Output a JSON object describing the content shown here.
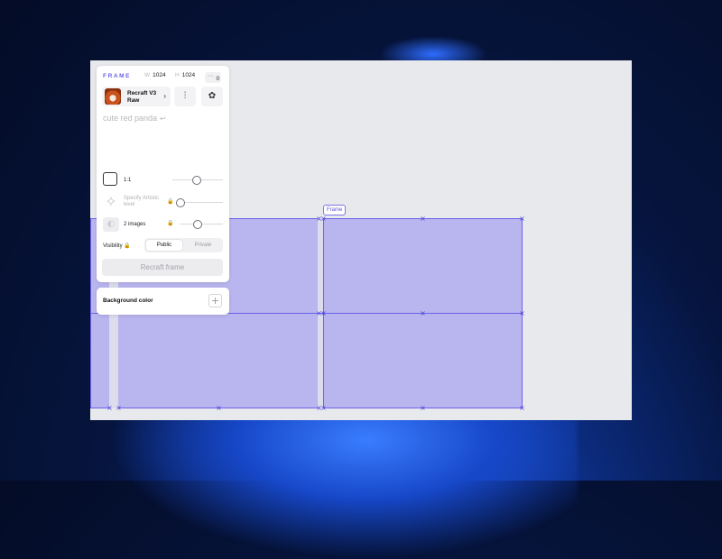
{
  "panel": {
    "title": "FRAME",
    "width_key": "W",
    "width_value": "1024",
    "height_key": "H",
    "height_value": "1024",
    "rotation_value": "0",
    "model": {
      "name": "Recraft V3 Raw",
      "chevron": "›"
    },
    "prompt": "cute red panda",
    "aspect": {
      "label": "1:1",
      "slider_level": 0.45
    },
    "artistic": {
      "label": "Specify Artistic level",
      "slider_level": 0.1
    },
    "images": {
      "label": "2 images",
      "slider_level": 0.4
    },
    "visibility": {
      "label": "Visibility",
      "options": [
        "Public",
        "Private"
      ],
      "selected": "Public"
    },
    "recraft_button": "Recraft frame"
  },
  "background": {
    "label": "Background color",
    "add_symbol": "+"
  },
  "canvas": {
    "frame_tag": "Frame",
    "selection_color": "#6b62e6",
    "fill_color": "#b9b5ef"
  },
  "icons": {
    "sliders": "sliders-icon",
    "palette": "palette-icon",
    "aspect": "aspect-ratio-icon",
    "sparkle": "sparkle-icon",
    "images": "images-icon",
    "lock": "lock-icon"
  }
}
